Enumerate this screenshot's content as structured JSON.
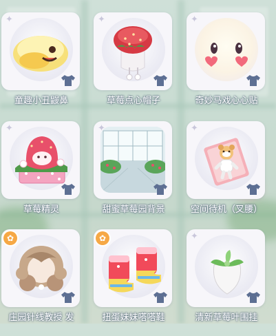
{
  "items": [
    {
      "label": "童趣小丑鼹鼻",
      "badge": "star",
      "icon": "clown-nose-icon"
    },
    {
      "label": "草莓点心帽子",
      "badge": "star",
      "icon": "strawberry-hat-icon"
    },
    {
      "label": "奇妙马戏心心贴",
      "badge": "star",
      "icon": "heart-sticker-icon"
    },
    {
      "label": "草莓精灵",
      "badge": "star",
      "icon": "strawberry-sprite-icon"
    },
    {
      "label": "甜蜜草莓园背景",
      "badge": "star",
      "icon": "garden-background-icon"
    },
    {
      "label": "空间待机（叉腰）",
      "badge": "star",
      "icon": "idle-pose-icon"
    },
    {
      "label": "庄园针线教授 发",
      "badge": "gear",
      "icon": "hair-icon"
    },
    {
      "label": "扭蛋妹妹嗒嗒鞋",
      "badge": "gear",
      "icon": "boots-icon"
    },
    {
      "label": "清新草莓叶围挂",
      "badge": "star",
      "icon": "leaf-ornament-icon"
    }
  ],
  "colors": {
    "accent_badge": "#f6a845",
    "shirt_icon": "#5d6f93"
  }
}
